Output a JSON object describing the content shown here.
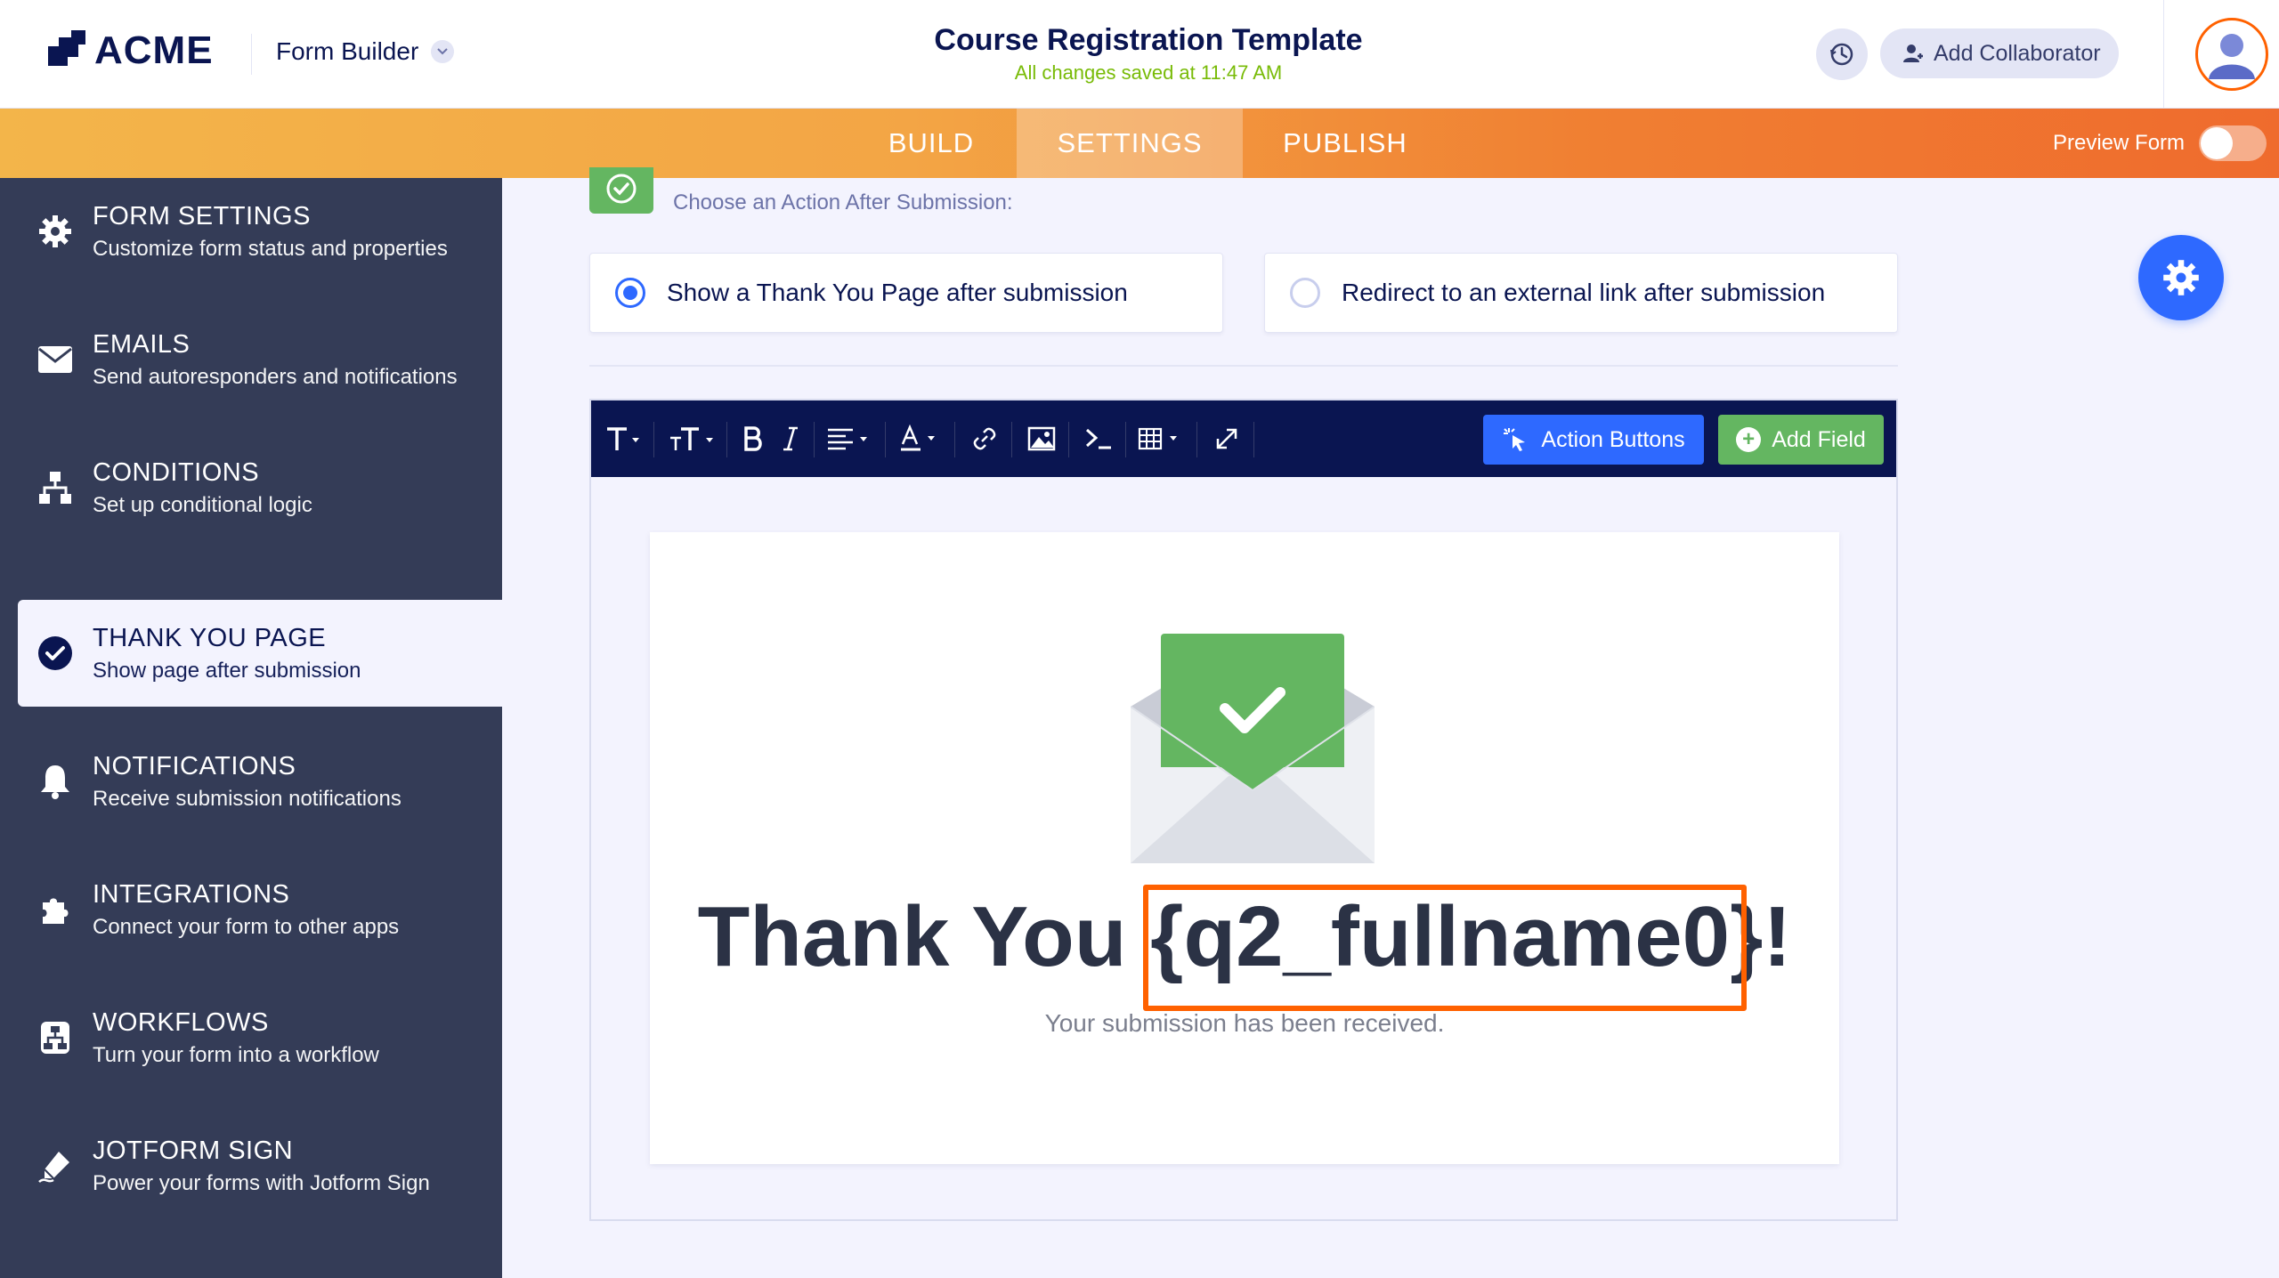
{
  "header": {
    "brand": "ACME",
    "app_menu": "Form Builder",
    "title": "Course Registration Template",
    "saved_status": "All changes saved at 11:47 AM",
    "add_collaborator": "Add Collaborator"
  },
  "nav": {
    "tabs": [
      {
        "label": "BUILD"
      },
      {
        "label": "SETTINGS"
      },
      {
        "label": "PUBLISH"
      }
    ],
    "active_tab": "SETTINGS",
    "preview_label": "Preview Form"
  },
  "sidebar": {
    "items": [
      {
        "title": "FORM SETTINGS",
        "subtitle": "Customize form status and properties",
        "icon": "gear-icon"
      },
      {
        "title": "EMAILS",
        "subtitle": "Send autoresponders and notifications",
        "icon": "envelope-icon"
      },
      {
        "title": "CONDITIONS",
        "subtitle": "Set up conditional logic",
        "icon": "sitemap-icon"
      },
      {
        "title": "THANK YOU PAGE",
        "subtitle": "Show page after submission",
        "icon": "check-circle-icon"
      },
      {
        "title": "NOTIFICATIONS",
        "subtitle": "Receive submission notifications",
        "icon": "bell-icon"
      },
      {
        "title": "INTEGRATIONS",
        "subtitle": "Connect your form to other apps",
        "icon": "puzzle-icon"
      },
      {
        "title": "WORKFLOWS",
        "subtitle": "Turn your form into a workflow",
        "icon": "workflow-icon"
      },
      {
        "title": "JOTFORM SIGN",
        "subtitle": "Power your forms with Jotform Sign",
        "icon": "pen-icon"
      }
    ],
    "active_item": "THANK YOU PAGE"
  },
  "main": {
    "section_subtitle": "Choose an Action After Submission:",
    "options": [
      {
        "label": "Show a Thank You Page after submission",
        "checked": true
      },
      {
        "label": "Redirect to an external link after submission",
        "checked": false
      }
    ],
    "toolbar": {
      "action_buttons": "Action Buttons",
      "add_field": "Add Field"
    },
    "canvas": {
      "heading_prefix": "Thank You ",
      "heading_variable": "{q2_fullname0}",
      "heading_suffix": "!",
      "subtext": "Your submission has been received."
    }
  },
  "colors": {
    "accent_blue": "#2e69ff",
    "success_green": "#64b661",
    "highlight_orange": "#ff6100",
    "sidebar_bg": "#343c57",
    "toolbar_bg": "#0a1551"
  }
}
